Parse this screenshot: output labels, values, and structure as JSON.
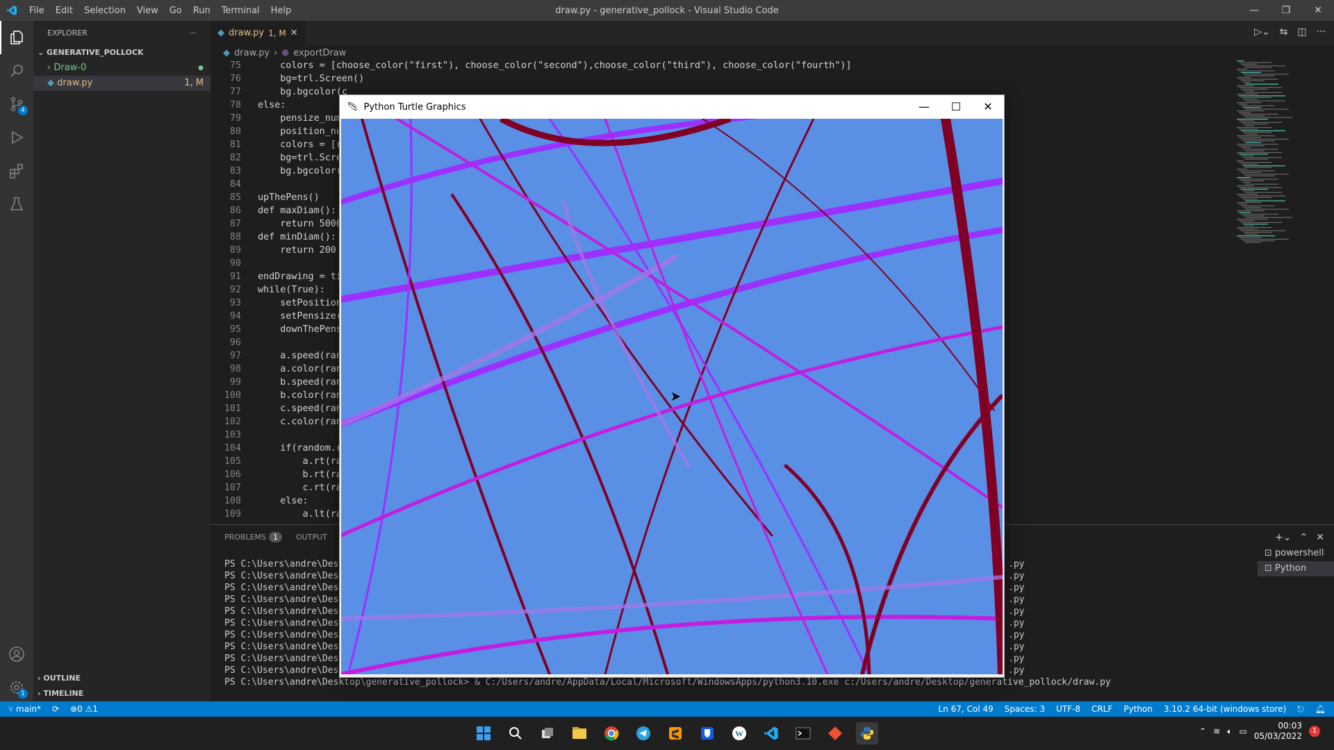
{
  "window": {
    "title": "draw.py - generative_pollock - Visual Studio Code"
  },
  "menu": [
    "File",
    "Edit",
    "Selection",
    "View",
    "Go",
    "Run",
    "Terminal",
    "Help"
  ],
  "window_controls": [
    "minimize-icon",
    "restore-icon",
    "close-icon"
  ],
  "activity_bar": {
    "scm_badge": "4",
    "settings_badge": "1"
  },
  "explorer": {
    "header": "EXPLORER",
    "folder": "GENERATIVE_POLLOCK",
    "items": [
      {
        "label": "Draw-0",
        "status": "●"
      },
      {
        "label": "draw.py",
        "status": "1, M"
      }
    ],
    "outline": "OUTLINE",
    "timeline": "TIMELINE"
  },
  "editor": {
    "tab": {
      "label": "draw.py",
      "status": "1, M"
    },
    "breadcrumb": [
      "draw.py",
      "exportDraw"
    ],
    "lines": [
      {
        "n": "75",
        "t": "    colors = [choose_color(\"first\"), choose_color(\"second\"),choose_color(\"third\"), choose_color(\"fourth\")]"
      },
      {
        "n": "76",
        "t": "    bg=trl.Screen()"
      },
      {
        "n": "77",
        "t": "    bg.bgcolor(c"
      },
      {
        "n": "78",
        "t": "else:"
      },
      {
        "n": "79",
        "t": "    pensize_num"
      },
      {
        "n": "80",
        "t": "    position_num"
      },
      {
        "n": "81",
        "t": "    colors = [ra"
      },
      {
        "n": "82",
        "t": "    bg=trl.Scree"
      },
      {
        "n": "83",
        "t": "    bg.bgcolor(r"
      },
      {
        "n": "84",
        "t": ""
      },
      {
        "n": "85",
        "t": "upThePens()"
      },
      {
        "n": "86",
        "t": "def maxDiam():"
      },
      {
        "n": "87",
        "t": "    return 5000"
      },
      {
        "n": "88",
        "t": "def minDiam():"
      },
      {
        "n": "89",
        "t": "    return 200"
      },
      {
        "n": "90",
        "t": ""
      },
      {
        "n": "91",
        "t": "endDrawing = ti"
      },
      {
        "n": "92",
        "t": "while(True):"
      },
      {
        "n": "93",
        "t": "    setPosition("
      },
      {
        "n": "94",
        "t": "    setPensize(p"
      },
      {
        "n": "95",
        "t": "    downThePens("
      },
      {
        "n": "96",
        "t": ""
      },
      {
        "n": "97",
        "t": "    a.speed(rand"
      },
      {
        "n": "98",
        "t": "    a.color(rand"
      },
      {
        "n": "99",
        "t": "    b.speed(rand"
      },
      {
        "n": "100",
        "t": "    b.color(rand"
      },
      {
        "n": "101",
        "t": "    c.speed(rand"
      },
      {
        "n": "102",
        "t": "    c.color(rand"
      },
      {
        "n": "103",
        "t": ""
      },
      {
        "n": "104",
        "t": "    if(random.ra"
      },
      {
        "n": "105",
        "t": "        a.rt(rand"
      },
      {
        "n": "106",
        "t": "        b.rt(rand"
      },
      {
        "n": "107",
        "t": "        c.rt(rand"
      },
      {
        "n": "108",
        "t": "    else:"
      },
      {
        "n": "109",
        "t": "        a.lt(rand"
      }
    ]
  },
  "panel": {
    "problems_label": "PROBLEMS",
    "problems_count": "1",
    "output_label": "OUTPUT",
    "terminal_lines": [
      "PS C:\\Users\\andre\\Deskt",
      "PS C:\\Users\\andre\\Deskt",
      "PS C:\\Users\\andre\\Deskt",
      "PS C:\\Users\\andre\\Deskt",
      "PS C:\\Users\\andre\\Deskt",
      "PS C:\\Users\\andre\\Deskt",
      "PS C:\\Users\\andre\\Deskt",
      "PS C:\\Users\\andre\\Deskt",
      "PS C:\\Users\\andre\\Deskt",
      "PS C:\\Users\\andre\\Deskt",
      "PS C:\\Users\\andre\\Desktop\\generative_pollock> & C:/Users/andre/AppData/Local/Microsoft/WindowsApps/python3.10.exe c:/Users/andre/Desktop/generative_pollock/draw.py"
    ],
    "terminal_tail": ".py",
    "terminals": [
      "powershell",
      "Python"
    ]
  },
  "status_bar": {
    "branch": "main*",
    "sync": "",
    "errors": "0",
    "warnings": "1",
    "position": "Ln 67, Col 49",
    "spaces": "Spaces: 3",
    "encoding": "UTF-8",
    "eol": "CRLF",
    "language": "Python",
    "interpreter": "3.10.2 64-bit (windows store)"
  },
  "taskbar": {
    "time": "00:03",
    "date": "05/03/2022",
    "notifications": "1",
    "apps": [
      "windows-start-icon",
      "search-icon",
      "task-view-icon",
      "file-explorer-icon",
      "chrome-icon",
      "telegram-icon",
      "sublime-icon",
      "bitwarden-icon",
      "wordpress-icon",
      "vscode-icon",
      "terminal-icon",
      "git-icon",
      "python-icon"
    ]
  },
  "turtle_window": {
    "title": "Python Turtle Graphics",
    "bg_color": "#5a8fe6",
    "stroke_colors": [
      "#800025",
      "#9b30ff",
      "#c21ee0",
      "#a676e8"
    ]
  },
  "colors": {
    "accent": "#007acc",
    "editor_bg": "#1e1e1e"
  }
}
